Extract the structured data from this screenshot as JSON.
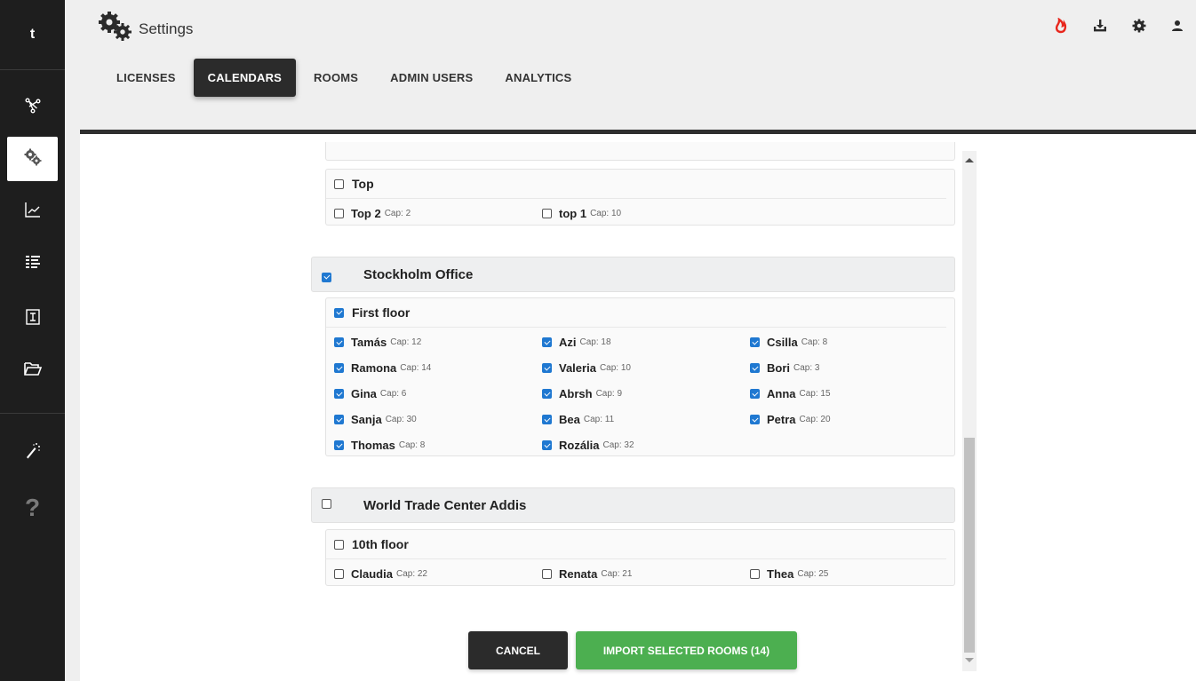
{
  "rail": {
    "logo": "t",
    "items": [
      {
        "icon": "workflow-icon"
      },
      {
        "icon": "settings-gears-icon",
        "active": true
      },
      {
        "icon": "chart-line-icon"
      },
      {
        "icon": "list-icon"
      },
      {
        "icon": "text-cursor-icon"
      },
      {
        "icon": "folder-open-icon"
      },
      {
        "icon": "magic-wand-icon"
      }
    ],
    "help": "?"
  },
  "header": {
    "title": "Settings",
    "tabs": [
      {
        "label": "LICENSES"
      },
      {
        "label": "CALENDARS",
        "active": true
      },
      {
        "label": "ROOMS"
      },
      {
        "label": "ADMIN USERS"
      },
      {
        "label": "ANALYTICS"
      }
    ],
    "icons": [
      "fire-icon",
      "download-icon",
      "gear-icon",
      "user-icon"
    ],
    "colors": {
      "fire": "#e8261c",
      "accent": "#1f78d1",
      "import": "#4caf50"
    }
  },
  "offices": [
    {
      "floors": [
        {
          "name": "Top",
          "checked": false,
          "rooms": [
            {
              "name": "Top 2",
              "cap": "Cap: 2",
              "checked": false
            },
            {
              "name": "top 1",
              "cap": "Cap: 10",
              "checked": false
            }
          ]
        }
      ]
    },
    {
      "name": "Stockholm Office",
      "checked": true,
      "floors": [
        {
          "name": "First floor",
          "checked": true,
          "rooms": [
            {
              "name": "Tamás",
              "cap": "Cap: 12",
              "checked": true
            },
            {
              "name": "Azi",
              "cap": "Cap: 18",
              "checked": true
            },
            {
              "name": "Csilla",
              "cap": "Cap: 8",
              "checked": true
            },
            {
              "name": "Ramona",
              "cap": "Cap: 14",
              "checked": true
            },
            {
              "name": "Valeria",
              "cap": "Cap: 10",
              "checked": true
            },
            {
              "name": "Bori",
              "cap": "Cap: 3",
              "checked": true
            },
            {
              "name": "Gina",
              "cap": "Cap: 6",
              "checked": true
            },
            {
              "name": "Abrsh",
              "cap": "Cap: 9",
              "checked": true
            },
            {
              "name": "Anna",
              "cap": "Cap: 15",
              "checked": true
            },
            {
              "name": "Sanja",
              "cap": "Cap: 30",
              "checked": true
            },
            {
              "name": "Bea",
              "cap": "Cap: 11",
              "checked": true
            },
            {
              "name": "Petra",
              "cap": "Cap: 20",
              "checked": true
            },
            {
              "name": "Thomas",
              "cap": "Cap: 8",
              "checked": true
            },
            {
              "name": "Rozália",
              "cap": "Cap: 32",
              "checked": true
            }
          ]
        }
      ]
    },
    {
      "name": "World Trade Center Addis",
      "checked": false,
      "floors": [
        {
          "name": "10th floor",
          "checked": false,
          "rooms": [
            {
              "name": "Claudia",
              "cap": "Cap: 22",
              "checked": false
            },
            {
              "name": "Renata",
              "cap": "Cap: 21",
              "checked": false
            },
            {
              "name": "Thea",
              "cap": "Cap: 25",
              "checked": false
            }
          ]
        }
      ]
    }
  ],
  "actions": {
    "cancel": "CANCEL",
    "import": "IMPORT SELECTED ROOMS (14)"
  }
}
